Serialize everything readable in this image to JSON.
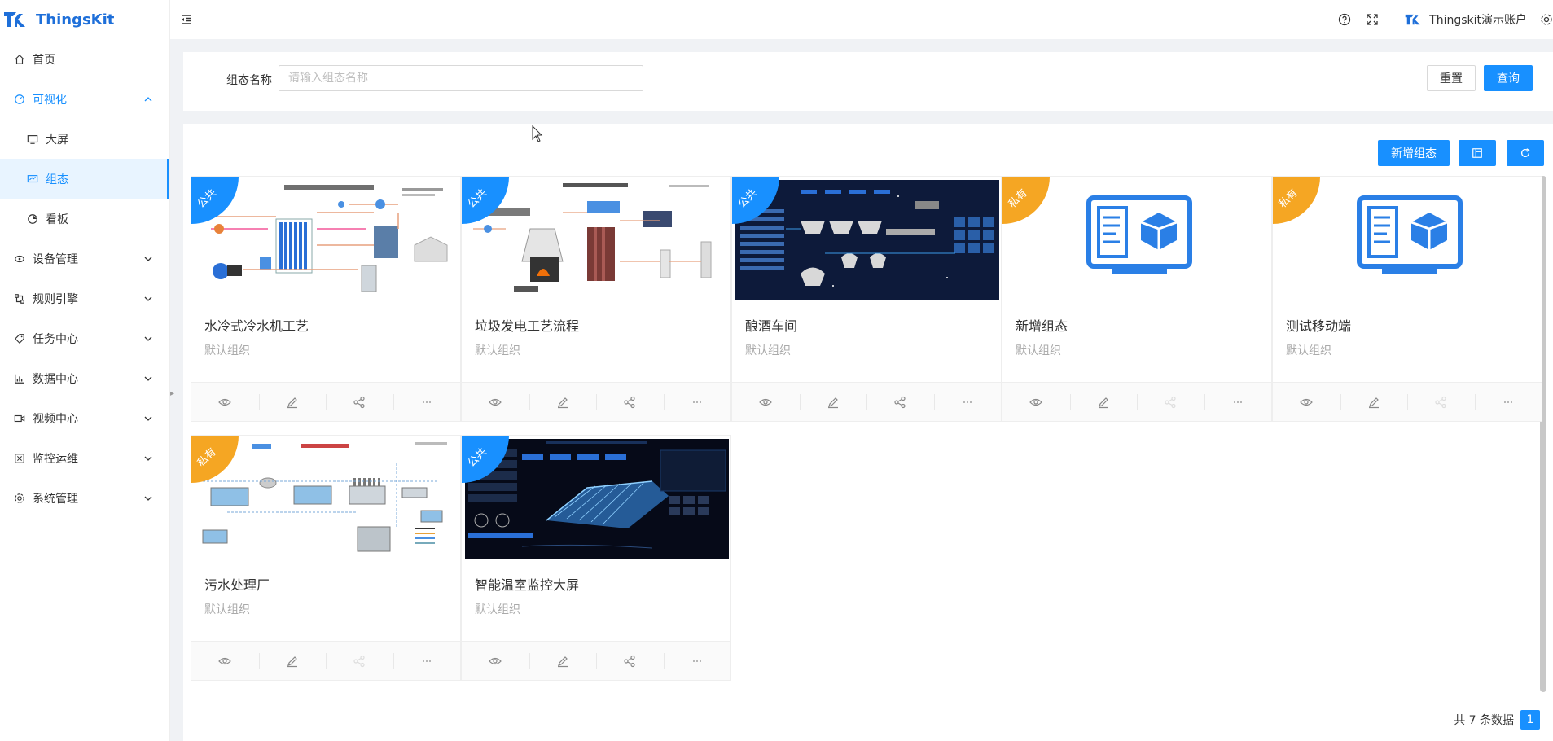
{
  "app": {
    "name": "ThingsKit"
  },
  "header": {
    "account": "Thingskit演示账户"
  },
  "sidebar": {
    "items": [
      {
        "label": "首页",
        "icon": "home-icon"
      },
      {
        "label": "可视化",
        "icon": "dashboard-icon",
        "expanded": true
      },
      {
        "label": "大屏",
        "icon": "screen-icon"
      },
      {
        "label": "组态",
        "icon": "config-icon",
        "selected": true
      },
      {
        "label": "看板",
        "icon": "pie-icon"
      },
      {
        "label": "设备管理",
        "icon": "device-icon"
      },
      {
        "label": "规则引擎",
        "icon": "rule-icon"
      },
      {
        "label": "任务中心",
        "icon": "tag-icon"
      },
      {
        "label": "数据中心",
        "icon": "bar-chart-icon"
      },
      {
        "label": "视频中心",
        "icon": "video-icon"
      },
      {
        "label": "监控运维",
        "icon": "monitor-icon"
      },
      {
        "label": "系统管理",
        "icon": "settings-icon"
      }
    ]
  },
  "search": {
    "label": "组态名称",
    "placeholder": "请输入组态名称",
    "reset": "重置",
    "query": "查询"
  },
  "toolbar": {
    "add": "新增组态"
  },
  "cards": [
    {
      "title": "水冷式冷水机工艺",
      "org": "默认组织",
      "badge": "公共",
      "badge_color": "#1890ff"
    },
    {
      "title": "垃圾发电工艺流程",
      "org": "默认组织",
      "badge": "公共",
      "badge_color": "#1890ff"
    },
    {
      "title": "酿酒车间",
      "org": "默认组织",
      "badge": "公共",
      "badge_color": "#1890ff"
    },
    {
      "title": "新增组态",
      "org": "默认组织",
      "badge": "私有",
      "badge_color": "#f5a623"
    },
    {
      "title": "测试移动端",
      "org": "默认组织",
      "badge": "私有",
      "badge_color": "#f5a623"
    },
    {
      "title": "污水处理厂",
      "org": "默认组织",
      "badge": "私有",
      "badge_color": "#f5a623"
    },
    {
      "title": "智能温室监控大屏",
      "org": "默认组织",
      "badge": "公共",
      "badge_color": "#1890ff"
    }
  ],
  "pagination": {
    "total_text": "共 7 条数据",
    "current": "1"
  }
}
